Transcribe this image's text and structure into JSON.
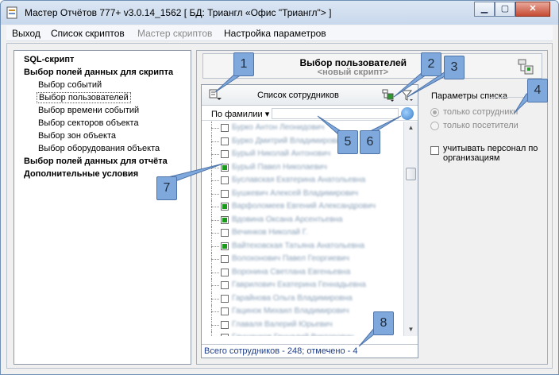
{
  "window": {
    "title": "Мастер Отчётов 777+ v3.0.14_1562 [ БД: Триангл «Офис \"Триангл\"> ]",
    "controls": [
      "minimize-icon",
      "maximize-icon",
      "close-icon"
    ]
  },
  "menu": {
    "items": [
      {
        "label": "Выход",
        "enabled": true
      },
      {
        "label": "Список скриптов",
        "enabled": true
      },
      {
        "label": "Мастер скриптов",
        "enabled": false
      },
      {
        "label": "Настройка параметров",
        "enabled": true
      }
    ]
  },
  "tree": {
    "items": [
      {
        "label": "SQL-скрипт",
        "bold": true
      },
      {
        "label": "Выбор полей данных для скрипта",
        "bold": true
      },
      {
        "label": "Выбор событий",
        "bold": false
      },
      {
        "label": "Выбор пользователей",
        "bold": false,
        "selected": true
      },
      {
        "label": "Выбор времени событий",
        "bold": false
      },
      {
        "label": "Выбор секторов объекта",
        "bold": false
      },
      {
        "label": "Выбор зон объекта",
        "bold": false
      },
      {
        "label": "Выбор оборудования объекта",
        "bold": false
      },
      {
        "label": "Выбор полей данных для отчёта",
        "bold": true
      },
      {
        "label": "Дополнительные условия",
        "bold": true
      }
    ]
  },
  "header": {
    "title": "Выбор пользователей",
    "subtitle": "<новый скрипт>"
  },
  "employee_list": {
    "title": "Список сотрудников",
    "sort_label": "По фамилии",
    "rows": [
      {
        "name": "Бурко Антон Леонидович",
        "checked": false
      },
      {
        "name": "Бурко Дмитрий Владимирович",
        "checked": false
      },
      {
        "name": "Бурый Николай Антонович",
        "checked": false
      },
      {
        "name": "Бурый Павел Николаевич",
        "checked": true
      },
      {
        "name": "Буславская Екатерина Анатольевна",
        "checked": false
      },
      {
        "name": "Бушкевич Алексей Владимирович",
        "checked": false
      },
      {
        "name": "Варфоломеев Евгений Александрович",
        "checked": true
      },
      {
        "name": "Вдовина Оксана Арсентьевна",
        "checked": true
      },
      {
        "name": "Вечинков Николай Г.",
        "checked": false
      },
      {
        "name": "Вайтеховская Татьяна Анатольевна",
        "checked": true
      },
      {
        "name": "Волохонович Павел Георгиевич",
        "checked": false
      },
      {
        "name": "Воронина Светлана Евгеньевна",
        "checked": false
      },
      {
        "name": "Гаврилович Екатерина Геннадьевна",
        "checked": false
      },
      {
        "name": "Гарайнова Ольга Владимировна",
        "checked": false
      },
      {
        "name": "Гацинок Михаил Владимирович",
        "checked": false
      },
      {
        "name": "Главаля Валерий Юрьевич",
        "checked": false
      },
      {
        "name": "Глушенков Геннадий Викторович",
        "checked": false
      }
    ],
    "status": "Всего сотрудников - 248; отмечено - 4"
  },
  "params": {
    "title": "Параметры списка",
    "radio_employees": "только сотрудники",
    "radio_visitors": "только посетители",
    "checkbox_label": "учитывать персонал по организациям"
  },
  "callouts": {
    "c1": "1",
    "c2": "2",
    "c3": "3",
    "c4": "4",
    "c5": "5",
    "c6": "6",
    "c7": "7",
    "c8": "8"
  },
  "colors": {
    "callout": "#7fa9dc",
    "status_text": "#1f3f8a",
    "checked": "#1a9a1a"
  }
}
